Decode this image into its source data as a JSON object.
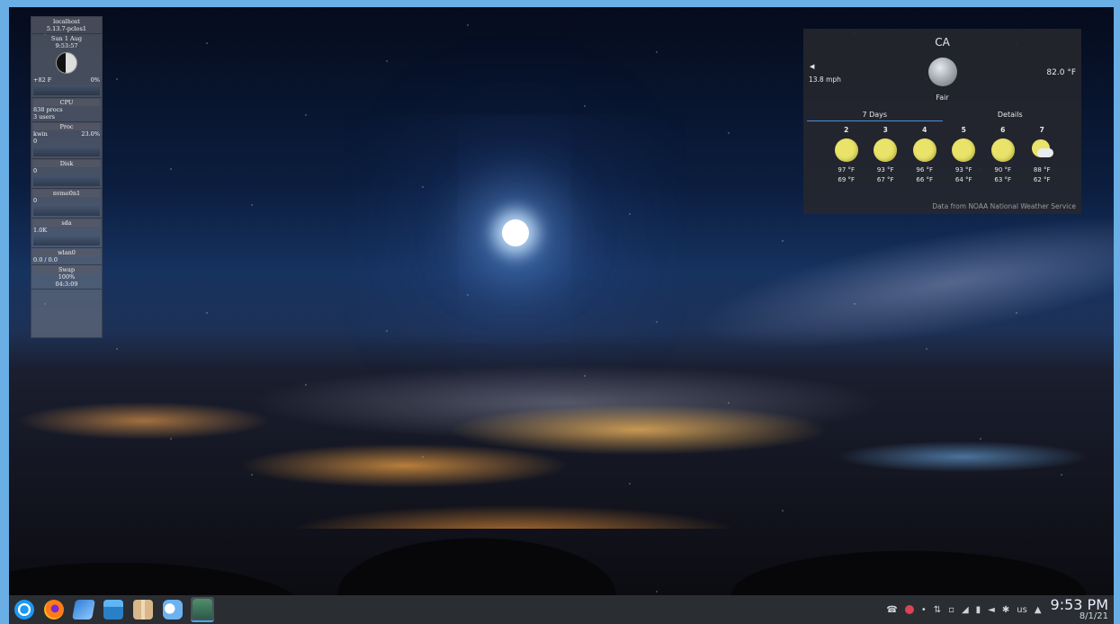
{
  "sysmon": {
    "host": "localhost",
    "kernel": "5.13.7-pclos1",
    "date_line": "Sun 1 Aug",
    "time": "9:53:57",
    "left_small": "+82 F",
    "right_small": "0%",
    "cpu_header": "CPU",
    "procs": "838 procs",
    "users": "3 users",
    "proc_header": "Proc",
    "proc_row_left": "kwin",
    "proc_row_right": "23.0%",
    "proc_val": "0",
    "disk_header": "Disk",
    "disk_val": "0",
    "nvme_header": "nvme0n1",
    "nvme_val": "0",
    "sda_header": "sda",
    "sda_val": "1.0K",
    "wlan_header": "wlan0",
    "wlan_row": "0.0 / 0.0",
    "swap_header": "Swap",
    "swap_pct": "100%",
    "uptime": "04:3:09"
  },
  "weather": {
    "location": "CA",
    "wind": "13.8 mph",
    "wind_icon": "wind-arrow-icon",
    "condition": "Fair",
    "current_temp": "82.0 °F",
    "tabs": [
      "7 Days",
      "Details"
    ],
    "active_tab": "7 Days",
    "days": [
      {
        "num": "2",
        "icon": "sunny",
        "hi": "97 °F",
        "lo": "69 °F"
      },
      {
        "num": "3",
        "icon": "sunny",
        "hi": "93 °F",
        "lo": "67 °F"
      },
      {
        "num": "4",
        "icon": "sunny",
        "hi": "96 °F",
        "lo": "66 °F"
      },
      {
        "num": "5",
        "icon": "sunny",
        "hi": "93 °F",
        "lo": "64 °F"
      },
      {
        "num": "6",
        "icon": "sunny",
        "hi": "90 °F",
        "lo": "63 °F"
      },
      {
        "num": "7",
        "icon": "partly-cloudy",
        "hi": "88 °F",
        "lo": "62 °F"
      }
    ],
    "credit": "Data from NOAA National Weather Service"
  },
  "taskbar": {
    "apps": [
      {
        "name": "application-launcher-icon",
        "style": "launcher"
      },
      {
        "name": "firefox-icon",
        "style": "firefox"
      },
      {
        "name": "drive-sync-icon",
        "style": "drive"
      },
      {
        "name": "file-manager-icon",
        "style": "files"
      },
      {
        "name": "archive-manager-icon",
        "style": "archive"
      },
      {
        "name": "chat-app-icon",
        "style": "chat"
      },
      {
        "name": "active-window-icon",
        "style": "winapp"
      }
    ],
    "tray": {
      "keyboard_layout": "us",
      "time": "9:53 PM",
      "date": "8/1/21"
    }
  },
  "colors": {
    "taskbar_bg": "#2a2d31",
    "accent": "#3daee9",
    "sun": "#e9e36a",
    "screen_border": "#6aaee6"
  }
}
